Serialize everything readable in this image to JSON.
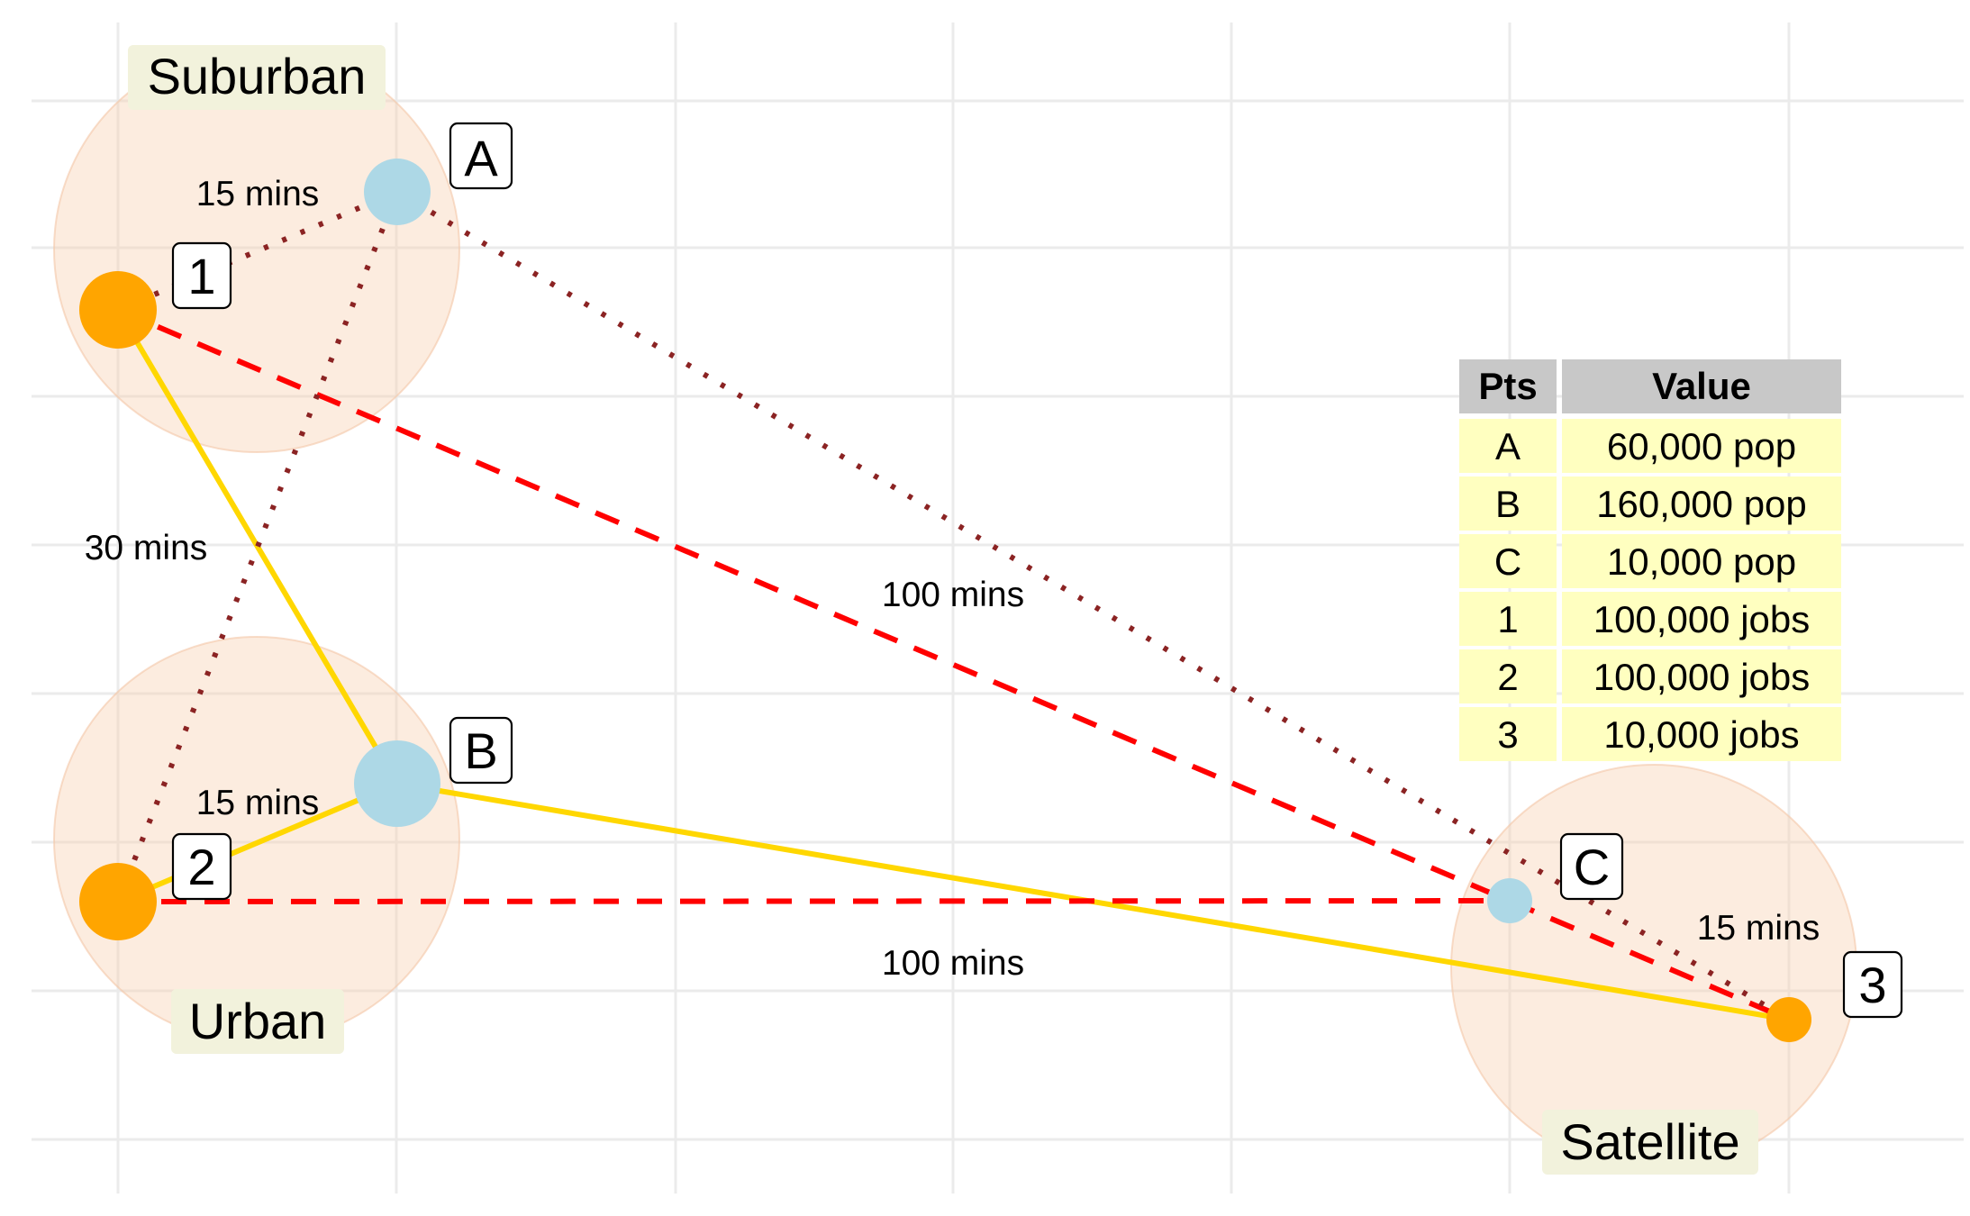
{
  "colors": {
    "job_point": "#FFA500",
    "pop_point": "#ADD8E6",
    "solid_line": "#FFD700",
    "dashed_line": "#FF0000",
    "dotted_line": "#8B2323",
    "region_fill": "#F8CFAE",
    "table_header": "#C8C8C8",
    "table_cell": "#FFFFC0"
  },
  "regions": [
    {
      "id": "suburban",
      "label": "Suburban"
    },
    {
      "id": "urban",
      "label": "Urban"
    },
    {
      "id": "satellite",
      "label": "Satellite"
    }
  ],
  "points": [
    {
      "id": "A",
      "label": "A",
      "kind": "pop"
    },
    {
      "id": "B",
      "label": "B",
      "kind": "pop"
    },
    {
      "id": "C",
      "label": "C",
      "kind": "pop"
    },
    {
      "id": "1",
      "label": "1",
      "kind": "job"
    },
    {
      "id": "2",
      "label": "2",
      "kind": "job"
    },
    {
      "id": "3",
      "label": "3",
      "kind": "job"
    }
  ],
  "links": [
    {
      "from": "1",
      "to": "B",
      "style": "solid"
    },
    {
      "from": "2",
      "to": "B",
      "style": "solid"
    },
    {
      "from": "B",
      "to": "3",
      "style": "solid"
    },
    {
      "from": "1",
      "to": "3",
      "style": "dashed"
    },
    {
      "from": "2",
      "to": "C",
      "style": "dashed"
    },
    {
      "from": "1",
      "to": "A",
      "style": "dotted"
    },
    {
      "from": "A",
      "to": "2",
      "style": "dotted"
    },
    {
      "from": "A",
      "to": "3",
      "style": "dotted"
    }
  ],
  "time_labels": [
    {
      "id": "suburban-15",
      "text": "15 mins"
    },
    {
      "id": "left-30",
      "text": "30 mins"
    },
    {
      "id": "upper-100",
      "text": "100 mins"
    },
    {
      "id": "urban-15",
      "text": "15 mins"
    },
    {
      "id": "lower-100",
      "text": "100 mins"
    },
    {
      "id": "satellite-15",
      "text": "15 mins"
    }
  ],
  "table": {
    "headers": [
      "Pts",
      "Value"
    ],
    "rows": [
      [
        "A",
        "60,000 pop"
      ],
      [
        "B",
        "160,000 pop"
      ],
      [
        "C",
        "10,000 pop"
      ],
      [
        "1",
        "100,000 jobs"
      ],
      [
        "2",
        "100,000 jobs"
      ],
      [
        "3",
        "10,000 jobs"
      ]
    ]
  }
}
